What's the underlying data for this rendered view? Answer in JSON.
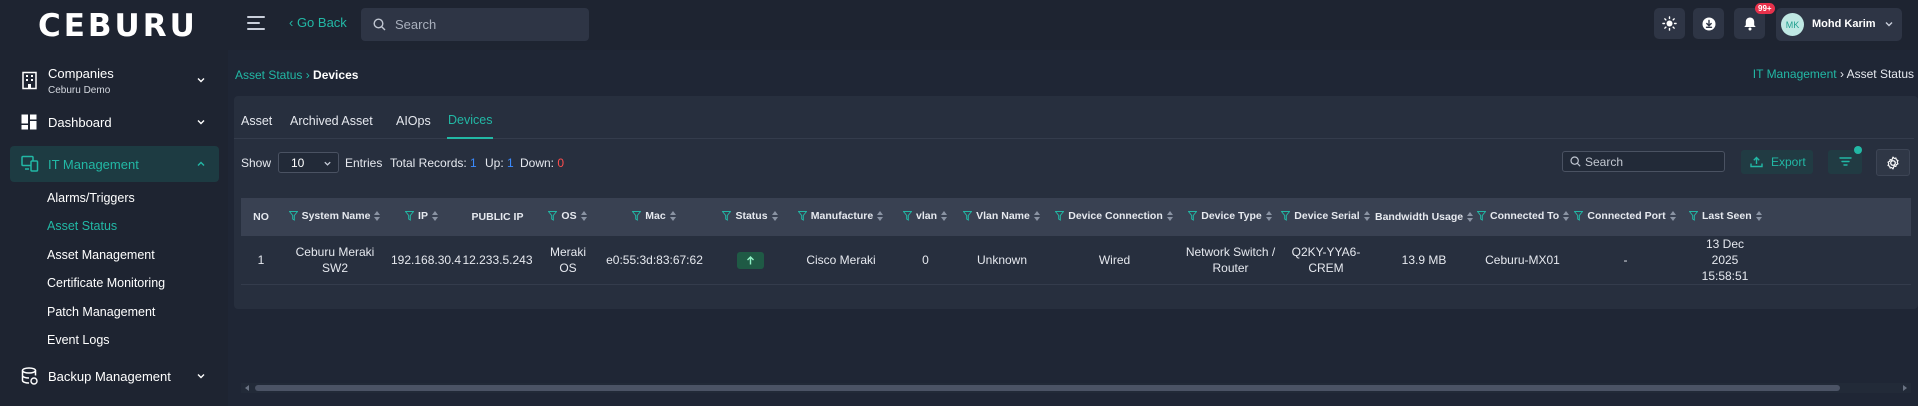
{
  "app": {
    "logo_text": "CEBURU",
    "go_back": "‹ Go Back",
    "search_placeholder": "Search"
  },
  "topbar": {
    "notification_badge": "99+",
    "user_initials": "MK",
    "user_name": "Mohd Karim"
  },
  "sidebar": {
    "companies": {
      "label": "Companies",
      "sub": "Ceburu Demo"
    },
    "dashboard": {
      "label": "Dashboard"
    },
    "it_management": {
      "label": "IT Management"
    },
    "sub_items": [
      "Alarms/Triggers",
      "Asset Status",
      "Asset Management",
      "Certificate Monitoring",
      "Patch Management",
      "Event Logs"
    ],
    "backup": {
      "label": "Backup Management"
    }
  },
  "breadcrumb": {
    "parent": "Asset Status",
    "sep": " › ",
    "current": "Devices"
  },
  "breadcrumb_right": {
    "parent": "IT Management",
    "sep": " › ",
    "current": "Asset Status"
  },
  "tabs": [
    "Asset",
    "Archived Asset",
    "AIOps",
    "Devices"
  ],
  "active_tab": "Devices",
  "controls": {
    "show_label": "Show",
    "entries_value": "10",
    "entries_label": "Entries",
    "total_label": "Total Records:",
    "total_value": "1",
    "up_label": "Up:",
    "up_value": "1",
    "down_label": "Down:",
    "down_value": "0",
    "search_placeholder": "Search",
    "export_label": "Export"
  },
  "table": {
    "headers": [
      "NO",
      "System Name",
      "IP",
      "PUBLIC IP",
      "OS",
      "Mac",
      "Status",
      "Manufacture",
      "vlan",
      "Vlan Name",
      "Device Connection",
      "Device Type",
      "Device Serial",
      "Bandwidth Usage",
      "Connected To",
      "Connected Port",
      "Last Seen"
    ],
    "rows": [
      {
        "no": "1",
        "system_name": "Ceburu Meraki SW2",
        "ip": "192.168.30.4",
        "public_ip": "12.233.5.243",
        "os": "Meraki OS",
        "mac": "e0:55:3d:83:67:62",
        "status": "up",
        "manufacture": "Cisco Meraki",
        "vlan": "0",
        "vlan_name": "Unknown",
        "device_connection": "Wired",
        "device_type": "Network Switch / Router",
        "device_serial": "Q2KY-YYA6-CREM",
        "bandwidth_usage": "13.9 MB",
        "connected_to": "Ceburu-MX01",
        "connected_port": "-",
        "last_seen": "13 Dec 2025 15:58:51"
      }
    ]
  },
  "colors": {
    "accent": "#22b8a5",
    "background": "#1f2635",
    "panel": "#272f3e",
    "down": "#ff4d4d",
    "up": "#3b8bff",
    "status_up": "#1f5a45"
  }
}
